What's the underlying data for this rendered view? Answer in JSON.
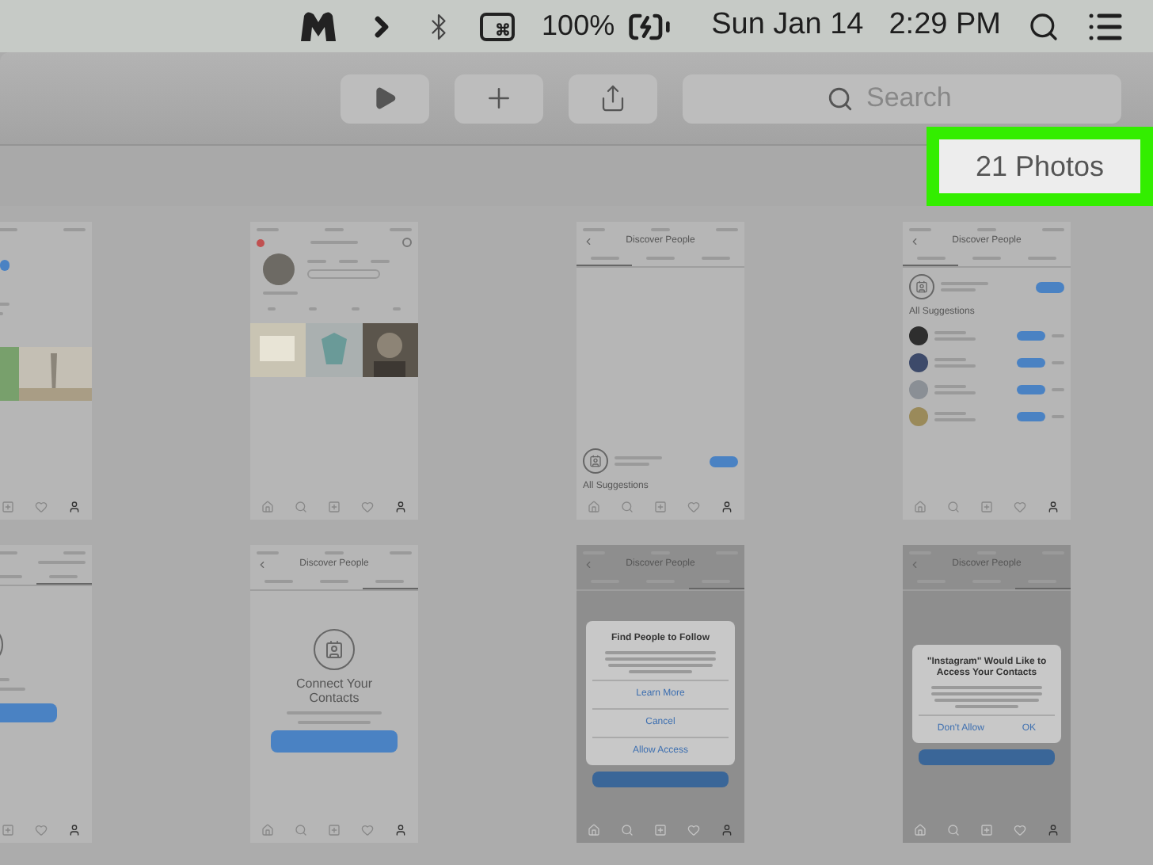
{
  "menubar": {
    "battery": "100%",
    "date": "Sun Jan 14",
    "time": "2:29 PM"
  },
  "toolbar": {
    "search": {
      "placeholder": "Search"
    }
  },
  "photo_count": {
    "label": "21 Photos",
    "highlighted": true
  },
  "photos": [
    {
      "kind": "partial_profile"
    },
    {
      "kind": "profile"
    },
    {
      "kind": "discover",
      "title": "Discover People",
      "section": "All Suggestions"
    },
    {
      "kind": "suggestions",
      "title": "Discover People",
      "section": "All Suggestions"
    },
    {
      "kind": "partial_contacts"
    },
    {
      "kind": "contacts",
      "title": "Discover People",
      "heading": "Connect Your Contacts"
    },
    {
      "kind": "dialog",
      "title": "Discover People",
      "dialog_title": "Find People to Follow",
      "actions": [
        "Learn More",
        "Cancel",
        "Allow Access"
      ]
    },
    {
      "kind": "alert",
      "title": "Discover People",
      "dialog_title": "\"Instagram\" Would Like to Access Your Contacts",
      "actions": [
        "Don't Allow",
        "OK"
      ]
    }
  ]
}
